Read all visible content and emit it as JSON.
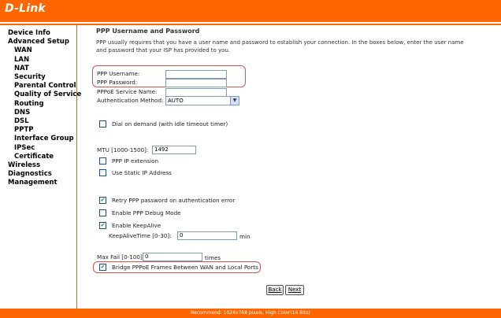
{
  "brand": "D-Link",
  "nav": [
    {
      "label": "Device Info",
      "sub": false
    },
    {
      "label": "Advanced Setup",
      "sub": false
    },
    {
      "label": "WAN",
      "sub": true
    },
    {
      "label": "LAN",
      "sub": true
    },
    {
      "label": "NAT",
      "sub": true
    },
    {
      "label": "Security",
      "sub": true
    },
    {
      "label": "Parental Control",
      "sub": true
    },
    {
      "label": "Quality of Service",
      "sub": true
    },
    {
      "label": "Routing",
      "sub": true
    },
    {
      "label": "DNS",
      "sub": true
    },
    {
      "label": "DSL",
      "sub": true
    },
    {
      "label": "PPTP",
      "sub": true
    },
    {
      "label": "Interface Group",
      "sub": true
    },
    {
      "label": "IPSec",
      "sub": true
    },
    {
      "label": "Certificate",
      "sub": true
    },
    {
      "label": "Wireless",
      "sub": false
    },
    {
      "label": "Diagnostics",
      "sub": false
    },
    {
      "label": "Management",
      "sub": false
    }
  ],
  "page": {
    "title": "PPP Username and Password",
    "description": "PPP usually requires that you have a user name and password to establish your connection. In the boxes below, enter the user name and password that your ISP has provided to you."
  },
  "form": {
    "username_label": "PPP Username:",
    "username_value": "",
    "password_label": "PPP Password:",
    "password_value": "",
    "service_label": "PPPoE Service Name:",
    "service_value": "",
    "auth_label": "Authentication Method:",
    "auth_value": "AUTO",
    "dial_on_demand": {
      "label": "Dial on demand (with idle timeout timer)",
      "checked": false
    },
    "mtu_label": "MTU [1000-1500]:",
    "mtu_value": "1492",
    "ppp_ip_ext": {
      "label": "PPP IP extension",
      "checked": false
    },
    "static_ip": {
      "label": "Use Static IP Address",
      "checked": false
    },
    "retry": {
      "label": "Retry PPP password on authentication error",
      "checked": true
    },
    "debug": {
      "label": "Enable PPP Debug Mode",
      "checked": false
    },
    "keepalive": {
      "label": "Enable KeepAlive",
      "checked": true
    },
    "keepalive_time_label": "KeepAliveTime [0-30]:",
    "keepalive_time_value": "0",
    "keepalive_time_unit": "min",
    "maxfail_label": "Max Fail [0-100]:",
    "maxfail_value": "0",
    "maxfail_unit": "times",
    "bridge": {
      "label": "Bridge PPPoE Frames Between WAN and Local Ports",
      "checked": true
    }
  },
  "buttons": {
    "back_label": "Back",
    "next_label": "Next"
  },
  "footer": "Recommend: 1024x768 pixels, High Color(16 Bits)",
  "colors": {
    "brand_orange": "#ff6600",
    "highlight": "#d9534f",
    "check": "#2a8a2a"
  }
}
